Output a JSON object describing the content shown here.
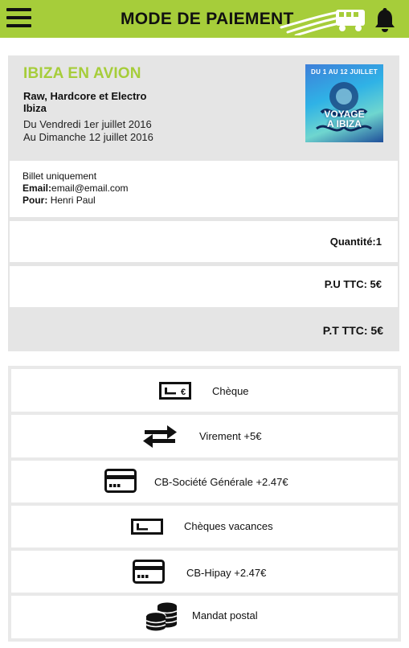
{
  "header": {
    "title": "MODE DE PAIEMENT",
    "menu_icon": "hamburger-menu-icon",
    "logo_icon": "bus-logo-icon",
    "notification_icon": "bell-icon"
  },
  "event": {
    "title": "IBIZA EN AVION",
    "genre": "Raw, Hardcore et Electro",
    "location": "Ibiza",
    "date_start": "Du Vendredi 1er juillet 2016",
    "date_end": "Au Dimanche 12 juillet 2016",
    "poster": {
      "top_text": "DU 1 AU 12 JUILLET",
      "main_line1": "VOYAGE",
      "main_line2": "A IBIZA"
    }
  },
  "ticket": {
    "type": "Billet uniquement",
    "email_label": "Email:",
    "email_value": "email@email.com",
    "for_label": "Pour:",
    "for_value": "Henri Paul"
  },
  "summary": {
    "quantity": "Quantité:1",
    "unit_price": "P.U TTC: 5€",
    "total_price": "P.T TTC: 5€"
  },
  "payment_methods": [
    {
      "label": "Chèque",
      "icon": "cheque-icon"
    },
    {
      "label": "Virement +5€",
      "icon": "transfer-arrows-icon"
    },
    {
      "label": "CB-Société Générale +2.47€",
      "icon": "credit-card-icon"
    },
    {
      "label": "Chèques vacances",
      "icon": "cheque-vacances-icon"
    },
    {
      "label": "CB-Hipay +2.47€",
      "icon": "credit-card-icon"
    },
    {
      "label": "Mandat postal",
      "icon": "coins-stack-icon"
    }
  ],
  "colors": {
    "brand_green": "#a6cd3a",
    "card_gray": "#e5e5e5"
  }
}
